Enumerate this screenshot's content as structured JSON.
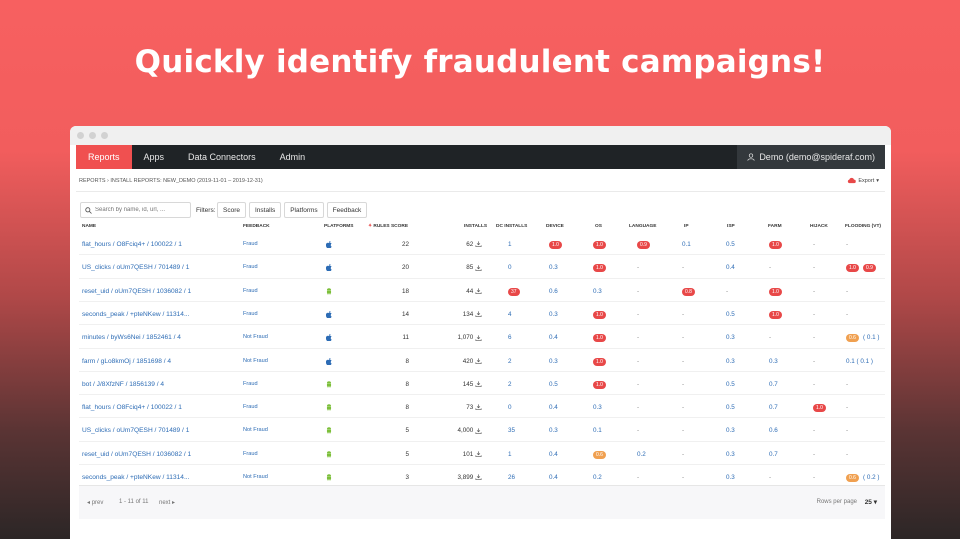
{
  "headline": "Quickly identify fraudulent campaigns!",
  "nav": {
    "items": [
      {
        "label": "Reports",
        "active": true
      },
      {
        "label": "Apps"
      },
      {
        "label": "Data Connectors"
      },
      {
        "label": "Admin"
      }
    ],
    "user": "Demo (demo@spideraf.com)"
  },
  "breadcrumb": "REPORTS › INSTALL REPORTS: NEW_DEMO (2019-11-01 – 2019-12-31)",
  "export_label": "Export",
  "search": {
    "placeholder": "Search by name, id, url, ..."
  },
  "filters": {
    "label": "Filters:",
    "buttons": [
      "Score",
      "Installs",
      "Platforms",
      "Feedback"
    ]
  },
  "columns": {
    "name": "NAME",
    "feedback": "FEEDBACK",
    "platforms": "PLATFORMS",
    "rules_score": "RULES SCORE",
    "installs": "INSTALLS",
    "dc_installs": "DC INSTALLS",
    "device": "DEVICE",
    "os": "OS",
    "language": "LANGUAGE",
    "ip": "IP",
    "isp": "ISP",
    "farm": "FARM",
    "hijack": "HIJACK",
    "flooding": "FLOODING (VT)"
  },
  "rows": [
    {
      "name": "flat_hours / O8Fciq4+ / 100022 / 1",
      "feedback": "Fraud",
      "platform": "apple",
      "score": "22",
      "installs": "62",
      "dc": "1",
      "device": "1.0",
      "os": "1.0",
      "language": "0.9",
      "ip": "0.1",
      "isp": "0.5",
      "farm": "1.0",
      "hijack": "-",
      "flooding": "-"
    },
    {
      "name": "US_clicks / oUm7QESH / 701489 / 1",
      "feedback": "Fraud",
      "platform": "apple",
      "score": "20",
      "installs": "85",
      "dc": "0",
      "device": "0.3",
      "os": "1.0",
      "language": "-",
      "ip": "-",
      "isp": "0.4",
      "farm": "-",
      "hijack": "-",
      "flooding": "1.0",
      "flooding2": "0.9"
    },
    {
      "name": "reset_uid / oUm7QESH / 1036082 / 1",
      "feedback": "Fraud",
      "platform": "android",
      "score": "18",
      "installs": "44",
      "dc": "37",
      "device": "0.6",
      "os": "0.3",
      "language": "-",
      "ip": "0.8",
      "isp": "-",
      "farm": "1.0",
      "hijack": "-",
      "flooding": "-"
    },
    {
      "name": "seconds_peak / +pteNKew / 11314...",
      "feedback": "Fraud",
      "platform": "apple",
      "score": "14",
      "installs": "134",
      "dc": "4",
      "device": "0.3",
      "os": "1.0",
      "language": "-",
      "ip": "-",
      "isp": "0.5",
      "farm": "1.0",
      "hijack": "-",
      "flooding": "-"
    },
    {
      "name": "minutes / byWs6Nei / 1852461 / 4",
      "feedback": "Not Fraud",
      "platform": "apple",
      "score": "11",
      "installs": "1,070",
      "dc": "6",
      "device": "0.4",
      "os": "1.0",
      "language": "-",
      "ip": "-",
      "isp": "0.3",
      "farm": "-",
      "hijack": "-",
      "flooding": "0.6",
      "flooding2": "( 0.1 )"
    },
    {
      "name": "farm / gLo8kmOj / 1851698 / 4",
      "feedback": "Not Fraud",
      "platform": "apple",
      "score": "8",
      "installs": "420",
      "dc": "2",
      "device": "0.3",
      "os": "1.0",
      "language": "-",
      "ip": "-",
      "isp": "0.3",
      "farm": "0.3",
      "hijack": "-",
      "flooding": "0.1 ( 0.1 )"
    },
    {
      "name": "bot / J/8XfzNF / 1856139 / 4",
      "feedback": "Fraud",
      "platform": "android",
      "score": "8",
      "installs": "145",
      "dc": "2",
      "device": "0.5",
      "os": "1.0",
      "language": "-",
      "ip": "-",
      "isp": "0.5",
      "farm": "0.7",
      "hijack": "-",
      "flooding": "-"
    },
    {
      "name": "flat_hours / O8Fciq4+ / 100022 / 1",
      "feedback": "Fraud",
      "platform": "android",
      "score": "8",
      "installs": "73",
      "dc": "0",
      "device": "0.4",
      "os": "0.3",
      "language": "-",
      "ip": "-",
      "isp": "0.5",
      "farm": "0.7",
      "hijack": "1.0",
      "flooding": "-"
    },
    {
      "name": "US_clicks / oUm7QESH / 701489 / 1",
      "feedback": "Not Fraud",
      "platform": "android",
      "score": "5",
      "installs": "4,000",
      "dc": "35",
      "device": "0.3",
      "os": "0.1",
      "language": "-",
      "ip": "-",
      "isp": "0.3",
      "farm": "0.6",
      "hijack": "-",
      "flooding": "-"
    },
    {
      "name": "reset_uid / oUm7QESH / 1036082 / 1",
      "feedback": "Fraud",
      "platform": "android",
      "score": "5",
      "installs": "101",
      "dc": "1",
      "device": "0.4",
      "os": "0.6",
      "language": "0.2",
      "ip": "-",
      "isp": "0.3",
      "farm": "0.7",
      "hijack": "-",
      "flooding": "-"
    },
    {
      "name": "seconds_peak / +pteNKew / 11314...",
      "feedback": "Not Fraud",
      "platform": "android",
      "score": "3",
      "installs": "3,899",
      "dc": "26",
      "device": "0.4",
      "os": "0.2",
      "language": "-",
      "ip": "-",
      "isp": "0.3",
      "farm": "-",
      "hijack": "-",
      "flooding": "0.6",
      "flooding2": "( 0.2 )"
    }
  ],
  "pills": {
    "0": [
      "device",
      "os",
      "language",
      "farm"
    ],
    "1": [
      "os",
      "flooding",
      "flooding2"
    ],
    "2": [
      "dc",
      "ip",
      "farm"
    ],
    "3": [
      "os",
      "farm"
    ],
    "4": [
      "os",
      "flooding:orange"
    ],
    "5": [
      "os"
    ],
    "6": [
      "os"
    ],
    "7": [
      "hijack"
    ],
    "8": [],
    "9": [
      "os:orange"
    ],
    "10": [
      "flooding:orange"
    ]
  },
  "pagination": {
    "prev": "prev",
    "range": "1 - 11 of 11",
    "next": "next",
    "rows_label": "Rows per page",
    "rows_value": "25"
  },
  "colors": {
    "accent": "#f05050",
    "link": "#2d6cb5",
    "nav_bg": "#1f2326",
    "pill_red": "#e84848",
    "pill_orange": "#f0a050",
    "android": "#7cbf3a"
  }
}
